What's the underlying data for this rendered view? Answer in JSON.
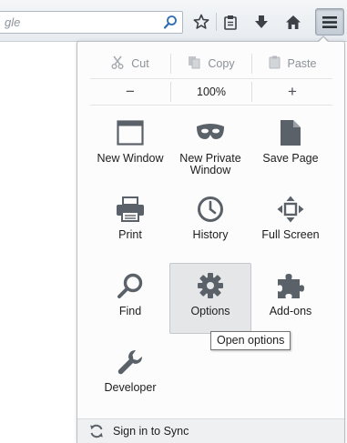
{
  "toolbar": {
    "search_placeholder": "gle",
    "icons": [
      "search-icon",
      "bookmark-star-icon",
      "bookmarks-list-icon",
      "download-icon",
      "home-icon",
      "menu-icon"
    ]
  },
  "menu": {
    "edit": {
      "cut": "Cut",
      "copy": "Copy",
      "paste": "Paste"
    },
    "zoom": {
      "out": "−",
      "level": "100%",
      "in": "+"
    },
    "items": [
      {
        "label": "New Window",
        "icon": "new-window-icon"
      },
      {
        "label": "New Private Window",
        "icon": "private-mask-icon"
      },
      {
        "label": "Save Page",
        "icon": "save-page-icon"
      },
      {
        "label": "Print",
        "icon": "printer-icon"
      },
      {
        "label": "History",
        "icon": "clock-icon"
      },
      {
        "label": "Full Screen",
        "icon": "fullscreen-icon"
      },
      {
        "label": "Find",
        "icon": "magnifier-icon"
      },
      {
        "label": "Options",
        "icon": "gear-icon"
      },
      {
        "label": "Add-ons",
        "icon": "puzzle-icon"
      },
      {
        "label": "Developer",
        "icon": "wrench-icon"
      }
    ],
    "tooltip": "Open options",
    "footer": {
      "sync_label": "Sign in to Sync",
      "icon": "sync-icon"
    }
  },
  "colors": {
    "icon_gray": "#5b6168",
    "disabled_gray": "#8c9197",
    "hover_bg": "#e4e6e8",
    "footer_bg": "#eef0f2"
  }
}
